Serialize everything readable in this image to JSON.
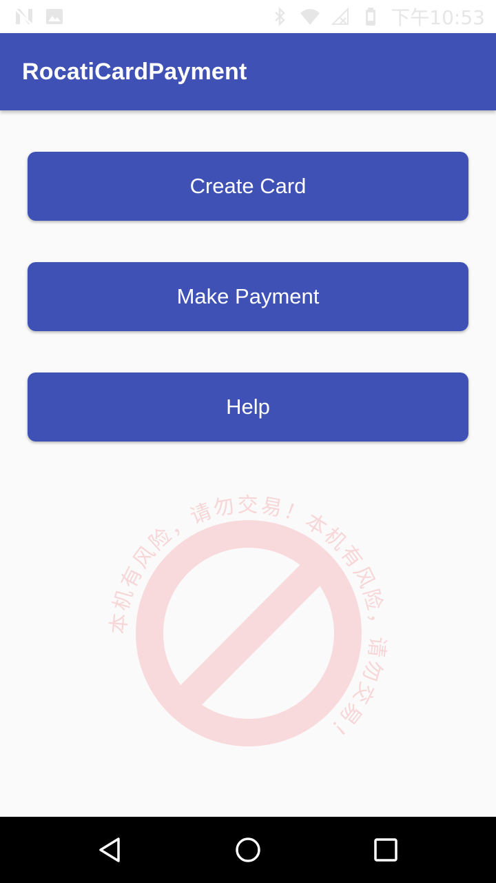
{
  "status_bar": {
    "time": "下午10:53",
    "icons": [
      "no-sim-icon",
      "image-icon",
      "bluetooth-icon",
      "wifi-icon",
      "no-signal-icon",
      "battery-icon"
    ]
  },
  "app_bar": {
    "title": "RocatiCardPayment",
    "color": "#3f51b5"
  },
  "buttons": {
    "create_card": "Create Card",
    "make_payment": "Make Payment",
    "help": "Help"
  },
  "watermark": {
    "text": "本机有风险，请勿交易！本机有风险，请勿交易！",
    "icon": "prohibited-icon",
    "color": "#f8d7d9"
  },
  "nav_bar": {
    "icons": [
      "back-icon",
      "home-icon",
      "recents-icon"
    ]
  }
}
